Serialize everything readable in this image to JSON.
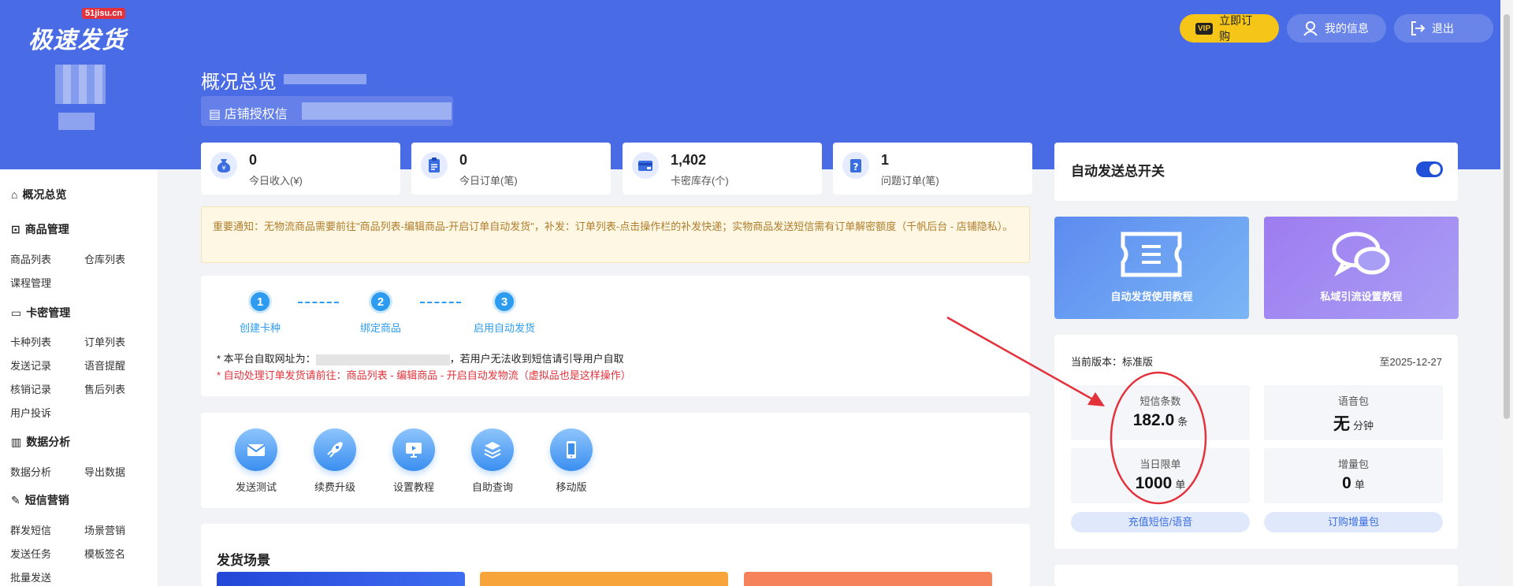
{
  "header": {
    "logo": "极速发货",
    "logo_badge": "51jisu.cn",
    "page_title": "概况总览",
    "shop_auth_label": "店铺授权信",
    "buttons": {
      "subscribe": "立即订购",
      "my_info": "我的信息",
      "logout": "退出"
    },
    "vip_tag": "VIP"
  },
  "sidebar": {
    "overview": "概况总览",
    "groups": [
      {
        "title": "商品管理",
        "items": [
          "商品列表",
          "仓库列表",
          "课程管理"
        ]
      },
      {
        "title": "卡密管理",
        "items": [
          "卡种列表",
          "订单列表",
          "发送记录",
          "语音提醒",
          "核销记录",
          "售后列表",
          "用户投诉"
        ]
      },
      {
        "title": "数据分析",
        "items": [
          "数据分析",
          "导出数据"
        ]
      },
      {
        "title": "短信营销",
        "items": [
          "群发短信",
          "场景营销",
          "发送任务",
          "模板签名",
          "批量发送"
        ]
      }
    ]
  },
  "stats": [
    {
      "value": "0",
      "label": "今日收入(¥)",
      "icon": "money-bag-icon"
    },
    {
      "value": "0",
      "label": "今日订单(笔)",
      "icon": "clipboard-icon"
    },
    {
      "value": "1,402",
      "label": "卡密库存(个)",
      "icon": "card-icon"
    },
    {
      "value": "1",
      "label": "问题订单(笔)",
      "icon": "question-icon"
    }
  ],
  "notice": "重要通知：无物流商品需要前往\"商品列表-编辑商品-开启订单自动发货\"，补发：订单列表-点击操作栏的补发快递；实物商品发送短信需有订单解密额度（千帆后台 - 店铺隐私）。",
  "steps": [
    {
      "num": "1",
      "label": "创建卡种"
    },
    {
      "num": "2",
      "label": "绑定商品"
    },
    {
      "num": "3",
      "label": "启用自动发货"
    }
  ],
  "pickup_line_prefix": "* 本平台自取网址为：",
  "pickup_line_suffix": "，若用户无法收到短信请引导用户自取",
  "auto_line": "* 自动处理订单发货请前往：商品列表 - 编辑商品 - 开启自动发物流（虚拟品也是这样操作）",
  "tools": [
    {
      "label": "发送测试",
      "icon": "mail-icon"
    },
    {
      "label": "续费升级",
      "icon": "rocket-icon"
    },
    {
      "label": "设置教程",
      "icon": "video-icon"
    },
    {
      "label": "自助查询",
      "icon": "layers-icon"
    },
    {
      "label": "移动版",
      "icon": "phone-icon"
    }
  ],
  "scene_title": "发货场景",
  "auto_send": {
    "title": "自动发送总开关",
    "enabled": true
  },
  "tutorials": [
    {
      "label": "自动发货使用教程",
      "icon": "ticket-icon"
    },
    {
      "label": "私域引流设置教程",
      "icon": "chat-icon"
    }
  ],
  "version": {
    "label": "当前版本：标准版",
    "expiry": "至2025-12-27"
  },
  "quotas": [
    {
      "label": "短信条数",
      "value": "182.0",
      "unit": "条"
    },
    {
      "label": "语音包",
      "value": "无",
      "unit": "分钟"
    },
    {
      "label": "当日限单",
      "value": "1000",
      "unit": "单"
    },
    {
      "label": "增量包",
      "value": "0",
      "unit": "单"
    }
  ],
  "quota_buttons": {
    "recharge": "充值短信/语音",
    "order_increment": "订购增量包"
  },
  "colors": {
    "primary": "#4a6be6",
    "accent": "#2d9cf0",
    "warning_text": "#b07d2c",
    "red": "#e3323b",
    "vip": "#f5c518"
  }
}
